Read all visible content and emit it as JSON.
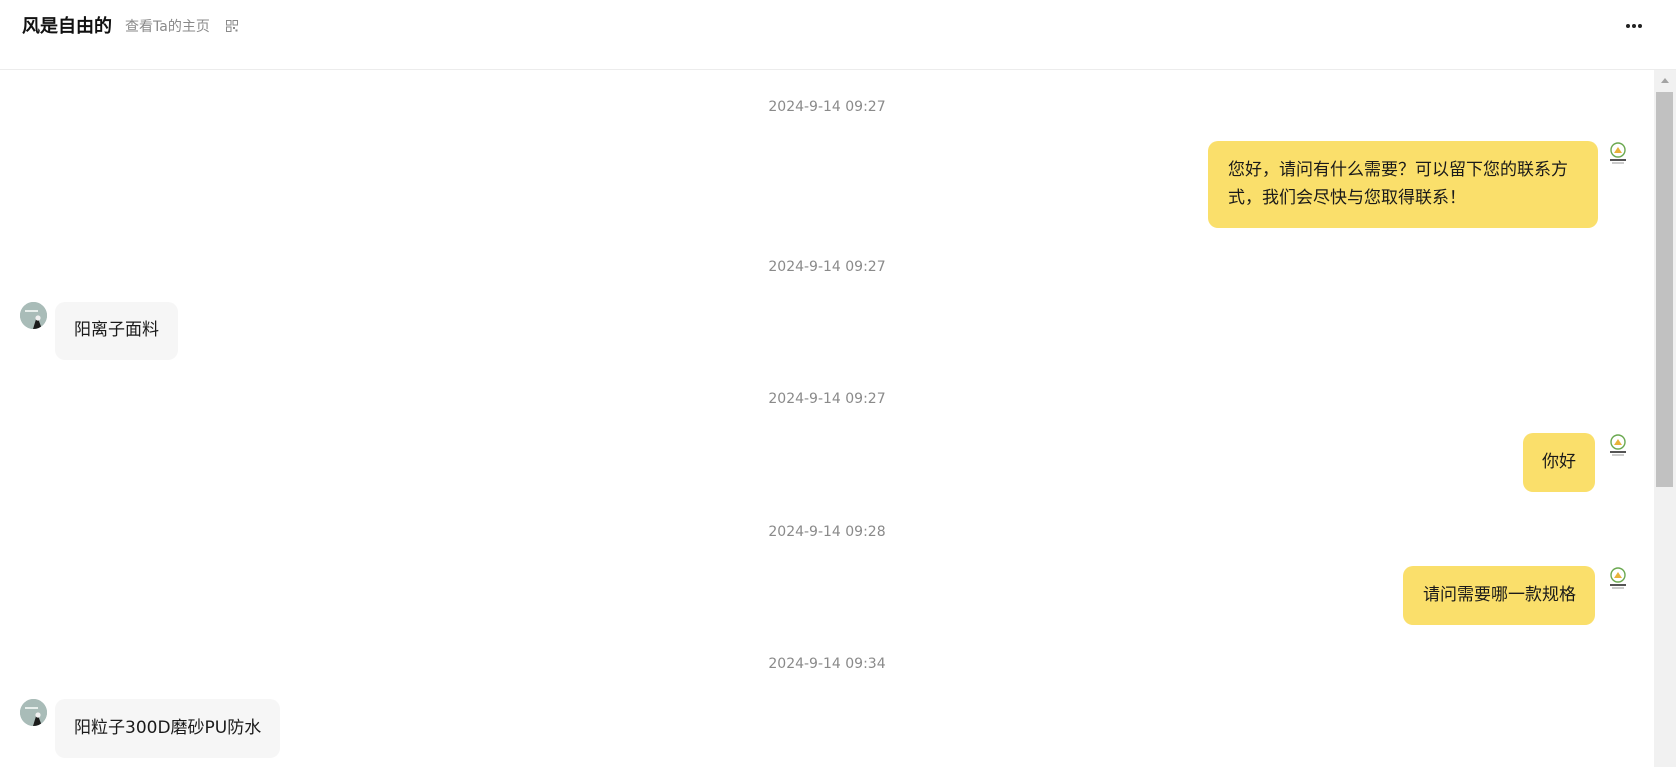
{
  "header": {
    "title": "风是自由的",
    "profile_link": "查看Ta的主页"
  },
  "messages": [
    {
      "timestamp": "2024-9-14 09:27",
      "side": "out",
      "lines": [
        "您好，请问有什么需要？可以留下您的联系方",
        "式，我们会尽快与您取得联系！"
      ]
    },
    {
      "timestamp": "2024-9-14 09:27",
      "side": "in",
      "lines": [
        "阳离子面料"
      ]
    },
    {
      "timestamp": "2024-9-14 09:27",
      "side": "out",
      "lines": [
        "你好"
      ]
    },
    {
      "timestamp": "2024-9-14 09:28",
      "side": "out",
      "lines": [
        "请问需要哪一款规格"
      ]
    },
    {
      "timestamp": "2024-9-14 09:34",
      "side": "in",
      "lines": [
        "阳粒子300D磨砂PU防水"
      ]
    }
  ],
  "colors": {
    "outgoing_bubble": "#fadf6b",
    "incoming_bubble": "#f6f6f6",
    "timestamp": "#8a8a8a"
  },
  "icons": {
    "qr": "qr-code-icon",
    "more": "more-horizontal-icon",
    "shop_avatar": "shop-logo-avatar",
    "customer_avatar": "customer-avatar"
  }
}
